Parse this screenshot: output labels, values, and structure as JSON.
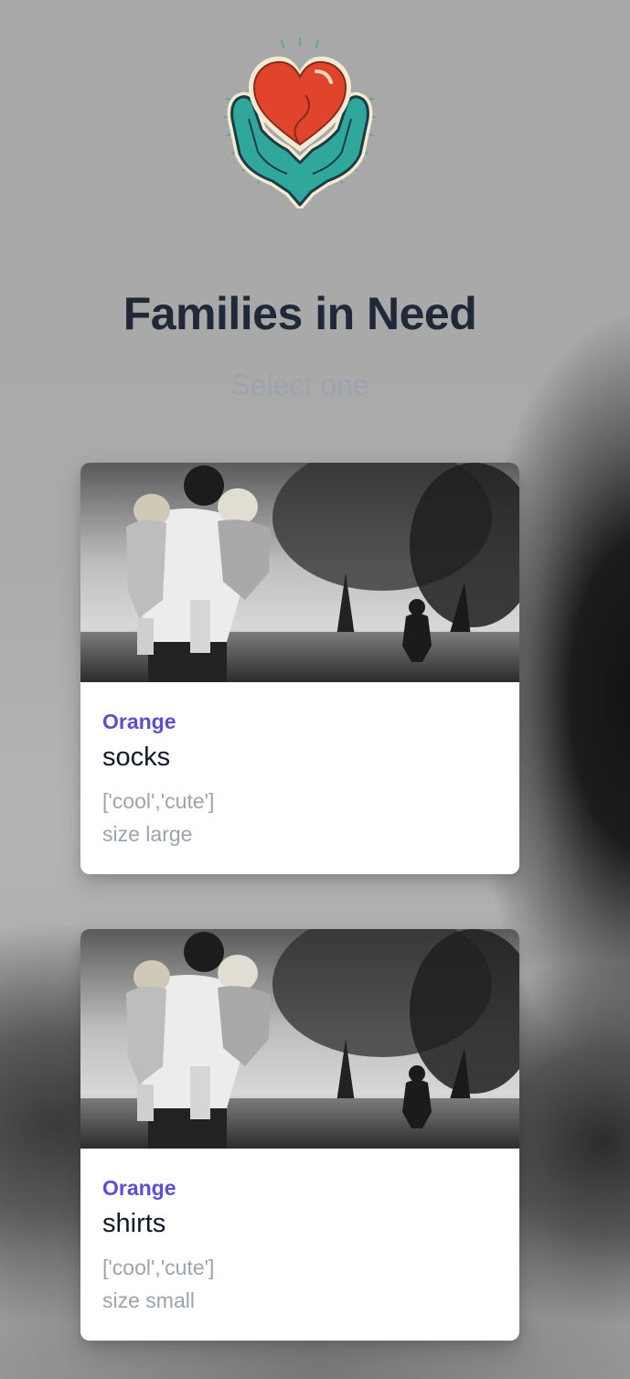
{
  "header": {
    "logo_icon": "heart-in-hands-icon",
    "title": "Families in Need",
    "subtitle": "Select one"
  },
  "colors": {
    "title": "#1f2937",
    "subtitle": "#9ca3af",
    "accent": "#5a4fd6",
    "card_background": "#ffffff",
    "logo_heart": "#e0452c",
    "logo_hands": "#2fa79a"
  },
  "cards": [
    {
      "image": "family-photo",
      "color": "Orange",
      "item": "socks",
      "tags": "['cool','cute']",
      "size": "size large"
    },
    {
      "image": "family-photo",
      "color": "Orange",
      "item": "shirts",
      "tags": "['cool','cute']",
      "size": "size small"
    }
  ]
}
